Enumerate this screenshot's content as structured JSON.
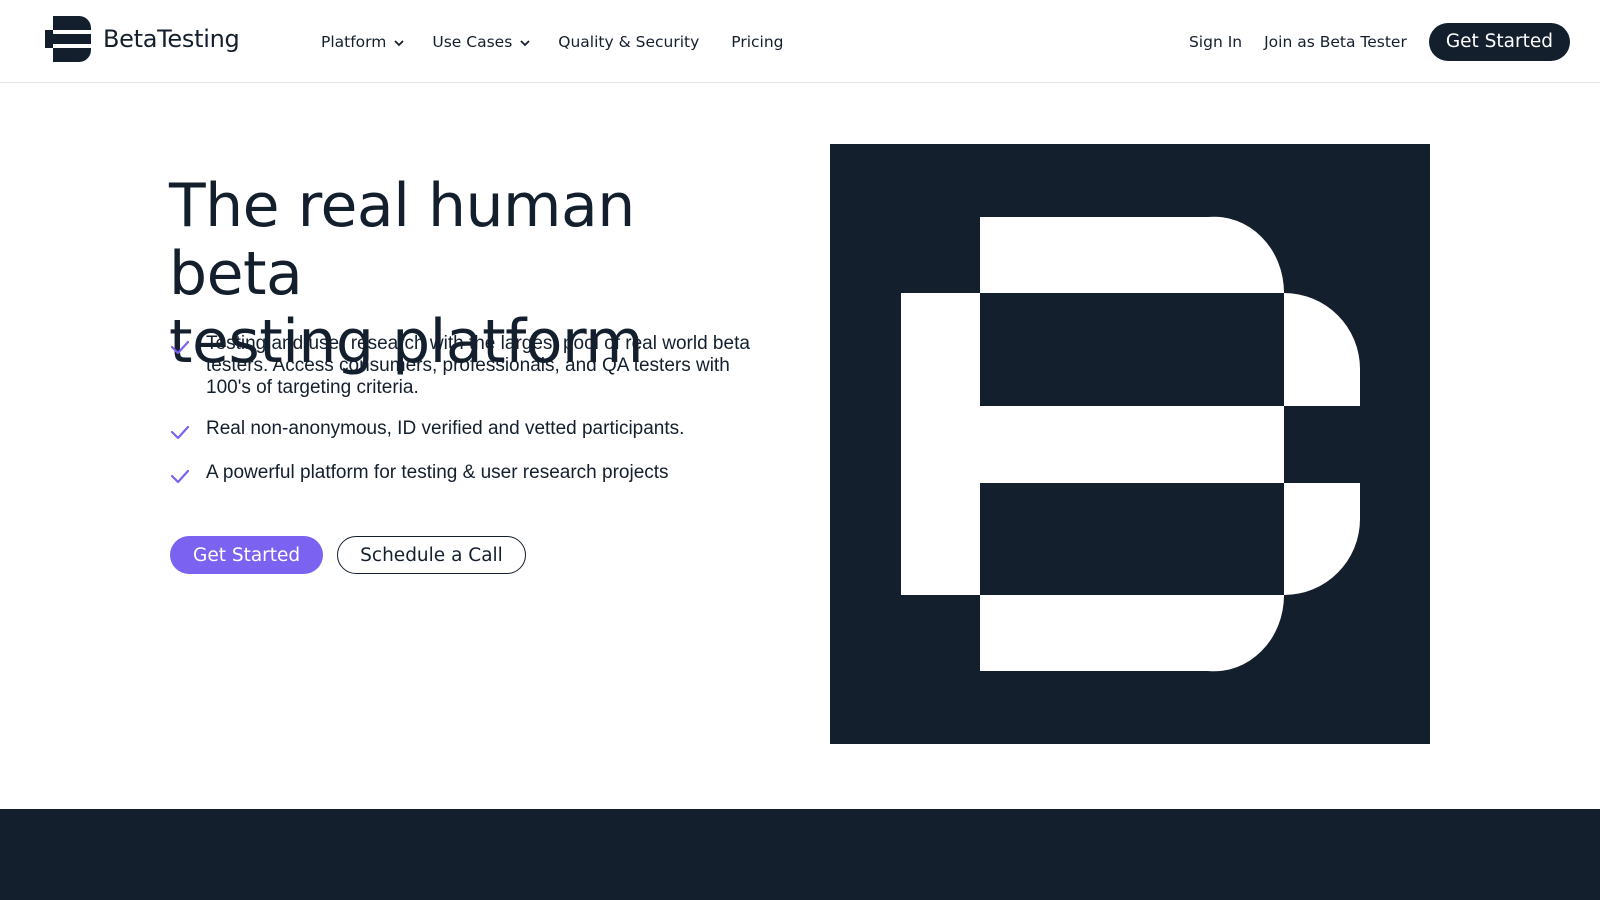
{
  "brand": {
    "name": "BetaTesting",
    "logo_icon": "stacked-b-logo-icon"
  },
  "nav": {
    "items": [
      {
        "label": "Platform",
        "has_dropdown": true
      },
      {
        "label": "Use Cases",
        "has_dropdown": true
      },
      {
        "label": "Quality & Security",
        "has_dropdown": false
      },
      {
        "label": "Pricing",
        "has_dropdown": false
      }
    ],
    "sign_in": "Sign In",
    "join": "Join as Beta Tester",
    "get_started": "Get Started"
  },
  "hero": {
    "title_line1": "The real human beta",
    "title_line2": "testing platform",
    "features": [
      "Testing and user research with the largest pool of real world beta testers. Access consumers, professionals, and QA testers with 100's of targeting criteria.",
      "Real non-anonymous, ID verified and vetted participants.",
      "A powerful platform for testing & user research projects"
    ],
    "primary_cta": "Get Started",
    "secondary_cta": "Schedule a Call",
    "graphic_icon": "large-b-logo-graphic"
  },
  "colors": {
    "navy": "#141f2d",
    "accent_purple": "#7b62f0",
    "check_purple": "#7b62f0",
    "white": "#ffffff"
  }
}
